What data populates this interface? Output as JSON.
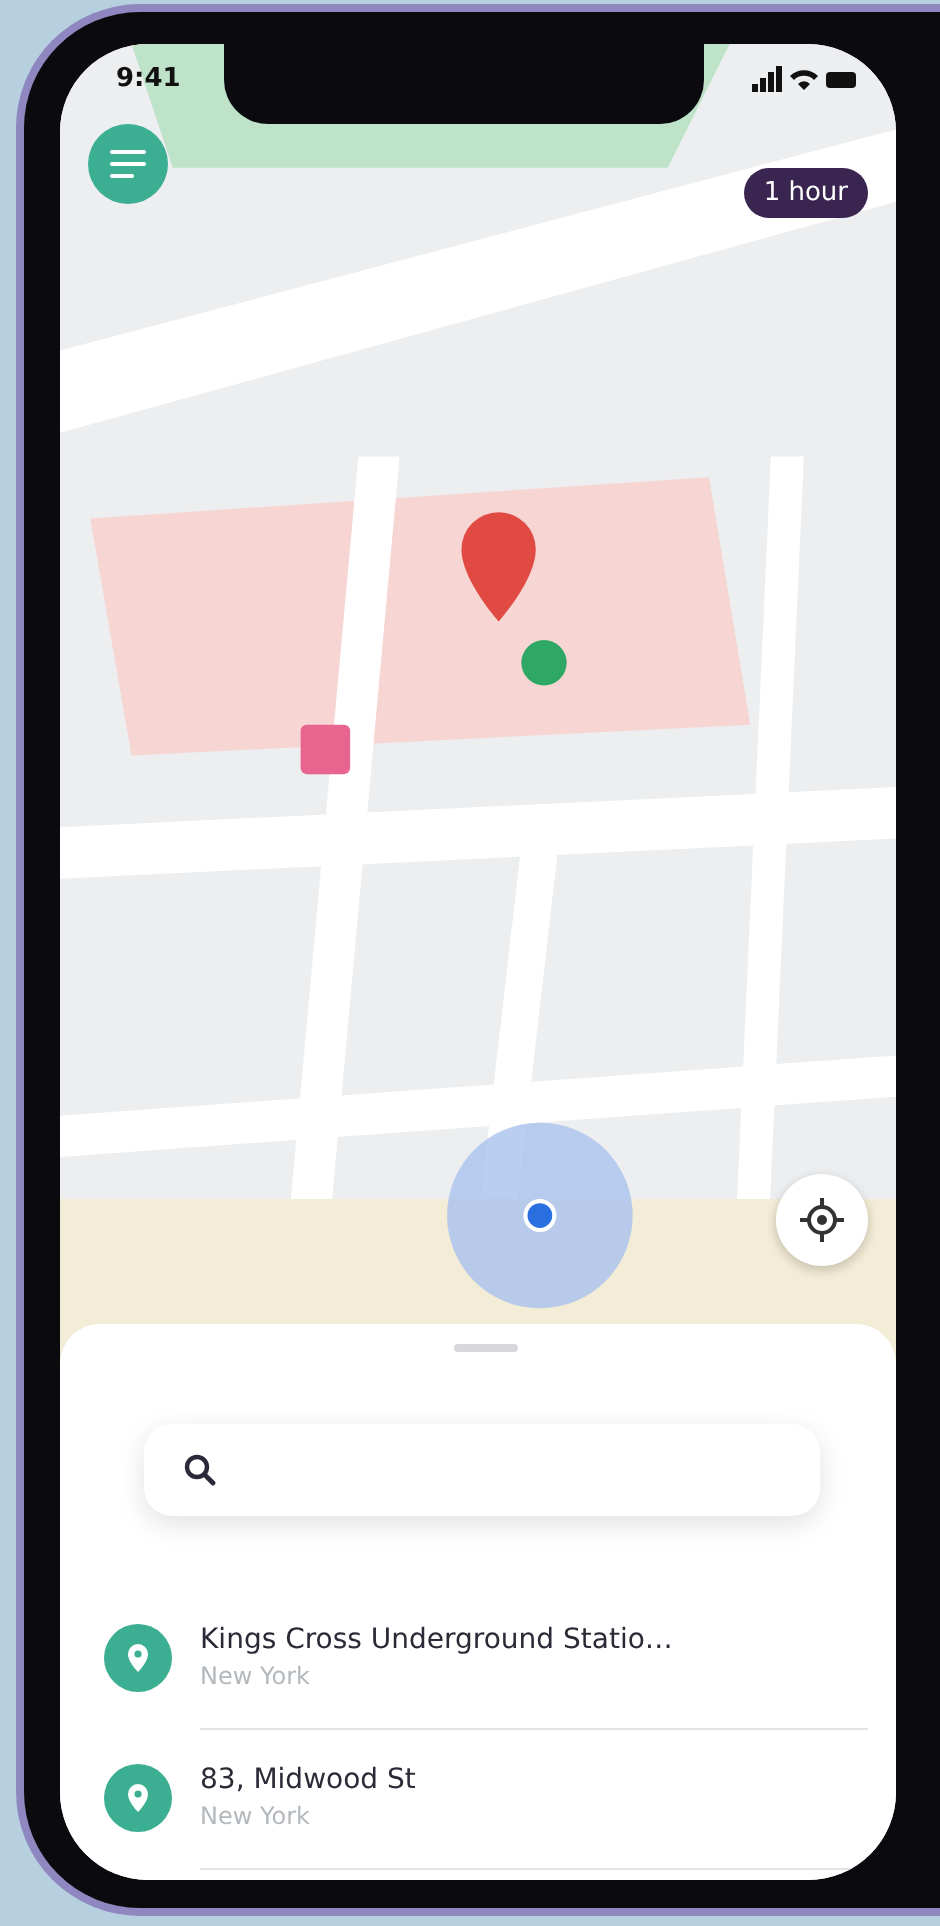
{
  "status_bar": {
    "time": "9:41"
  },
  "map": {
    "badge": "1 hour"
  },
  "places": [
    {
      "name": "Kings Cross Underground Statio…",
      "city": "New York"
    },
    {
      "name": "83, Midwood St",
      "city": "New York"
    }
  ]
}
